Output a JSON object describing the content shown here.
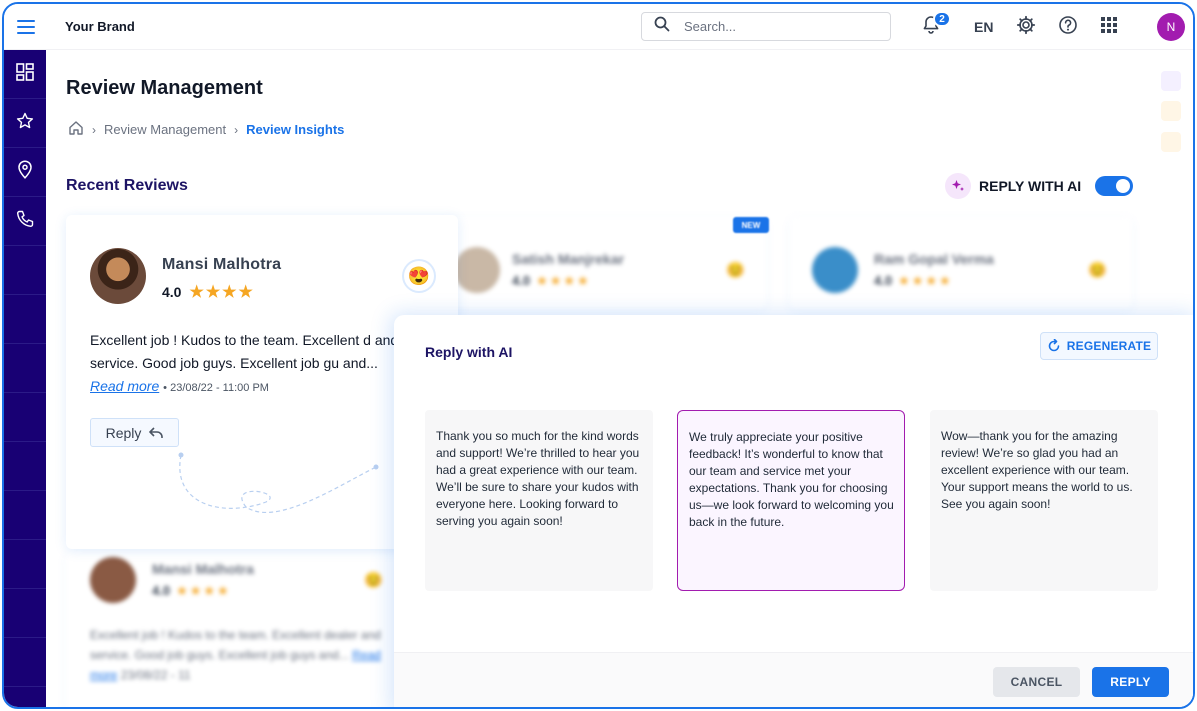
{
  "header": {
    "brand": "Your Brand",
    "search_placeholder": "Search...",
    "notifications_count": "2",
    "language": "EN",
    "user_initial": "N"
  },
  "sidebar": {
    "items": [
      {
        "icon": "dashboard-icon"
      },
      {
        "icon": "star-icon"
      },
      {
        "icon": "location-pin-icon"
      },
      {
        "icon": "phone-icon"
      }
    ]
  },
  "page": {
    "title": "Review Management",
    "breadcrumb": [
      "Review Management",
      "Review Insights"
    ],
    "section_title": "Recent Reviews",
    "reply_with_ai_label": "REPLY WITH AI",
    "reply_with_ai_enabled": true
  },
  "review": {
    "name": "Mansi Malhotra",
    "rating": "4.0",
    "stars": "★★★★",
    "text": "Excellent job ! Kudos to the team. Excellent d and service. Good job guys. Excellent job gu and...",
    "read_more": "Read more",
    "date": "23/08/22 - 11:00 PM",
    "reply_label": "Reply"
  },
  "background_reviews": [
    {
      "name": "Satish Manjrekar",
      "rating": "4.0",
      "stars": "★★★★",
      "tag": "NEW"
    },
    {
      "name": "Ram Gopal Verma",
      "rating": "4.0",
      "stars": "★★★★"
    },
    {
      "name": "Mansi Malhotra",
      "rating": "4.0",
      "stars": "★★★★",
      "text": "Excellent job ! Kudos to the team. Excellent dealer and service. Good job guys. Excellent job guys and...",
      "read_more": "Read more",
      "date": "23/08/22 - 11"
    }
  ],
  "ai_panel": {
    "title": "Reply with AI",
    "regenerate_label": "REGENERATE",
    "suggestions": [
      "Thank you so much for the kind words and support! We’re thrilled to hear you had a great experience with our team. We’ll be sure to share your kudos with everyone here. Looking forward to serving you again soon!",
      "We truly appreciate your positive feedback! It’s wonderful to know that our team and service met your expectations. Thank you for choosing us—we look forward to welcoming you back in the future.",
      "Wow—thank you for the amazing review! We’re so glad you had an excellent experience with our team. Your support means the world to us. See you again soon!"
    ],
    "selected_index": 1,
    "cancel_label": "CANCEL",
    "reply_label": "REPLY"
  },
  "colors": {
    "primary": "#1a73e8",
    "sidebar": "#180074",
    "accent_purple": "#a21caf",
    "star": "#f5a623"
  }
}
